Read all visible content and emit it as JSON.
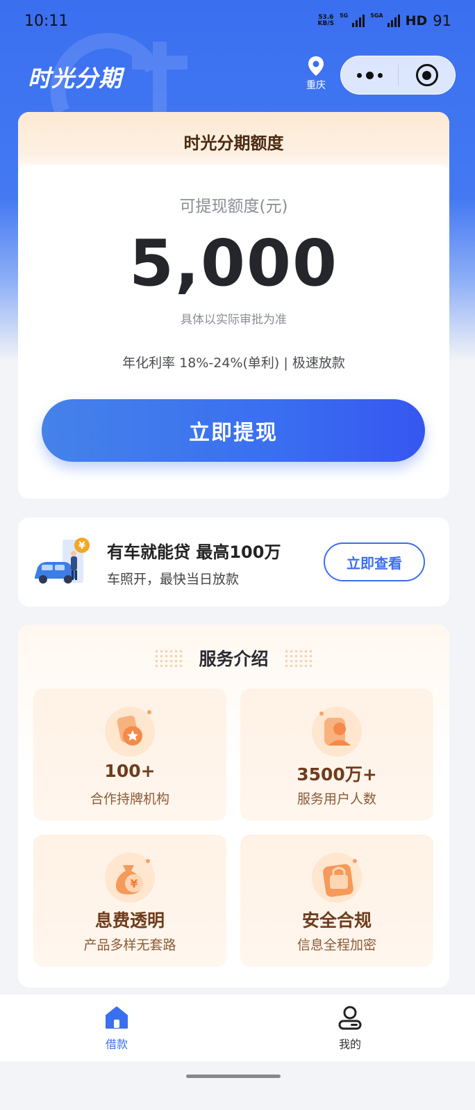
{
  "status_bar": {
    "time": "10:11",
    "net_speed_top": "53.6",
    "net_speed_bottom": "KB/S",
    "signal1_label": "5G",
    "signal2_label": "5GA",
    "hd": "HD",
    "battery": "91"
  },
  "header": {
    "app_title": "时光分期",
    "location": "重庆",
    "icons": [
      "location-pin-icon",
      "more-dots-icon",
      "target-icon"
    ]
  },
  "credit": {
    "title": "时光分期额度",
    "amount_label": "可提现额度(元)",
    "amount": "5,000",
    "note": "具体以实际审批为准",
    "rate_line": "年化利率 18%-24%(单利) | 极速放款",
    "withdraw_button": "立即提现"
  },
  "car_loan": {
    "title": "有车就能贷 最高100万",
    "subtitle": "车照开，最快当日放款",
    "button": "立即查看",
    "badge_symbol": "¥"
  },
  "service": {
    "title": "服务介绍",
    "tiles": [
      {
        "value": "100+",
        "desc": "合作持牌机构",
        "icon": "license-badge-icon"
      },
      {
        "value": "3500万+",
        "desc": "服务用户人数",
        "icon": "user-icon"
      },
      {
        "value": "息费透明",
        "desc": "产品多样无套路",
        "icon": "money-bag-icon"
      },
      {
        "value": "安全合规",
        "desc": "信息全程加密",
        "icon": "lock-icon"
      }
    ]
  },
  "bottom_nav": {
    "items": [
      {
        "label": "借款",
        "icon": "home-icon",
        "active": true
      },
      {
        "label": "我的",
        "icon": "profile-icon",
        "active": false
      }
    ]
  },
  "colors": {
    "primary": "#3a6ff0",
    "accent_brown": "#6e3c1c",
    "badge_orange": "#f5a623"
  }
}
